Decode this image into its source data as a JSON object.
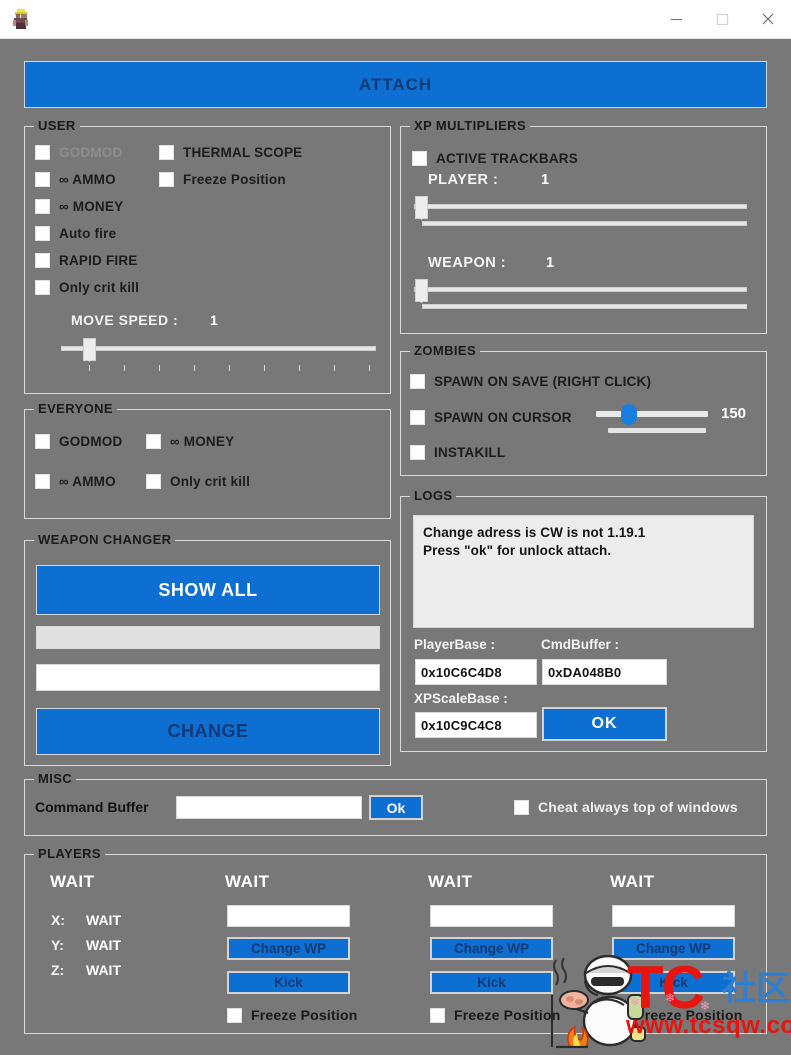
{
  "window": {
    "title": "",
    "icon": "app-character-icon",
    "minimize_label": "–",
    "maximize_label": "☐",
    "close_label": "✕"
  },
  "colors": {
    "accent_blue": "#0d6fd1",
    "window_bg": "#787878",
    "group_border": "#d9d9d9",
    "button_text": "#ffffff",
    "dark_button_text": "#113a78",
    "disabled_text": "#8e8e8e",
    "slider_thumb": "#1a7ee0",
    "watermark_red": "#e8140f",
    "watermark_blue": "#2f7fd0"
  },
  "attach": {
    "label": "ATTACH"
  },
  "user": {
    "legend": "USER",
    "checks_col1": [
      {
        "label": "GODMOD",
        "checked": false,
        "disabled": true
      },
      {
        "label": "∞ AMMO",
        "checked": false,
        "disabled": false
      },
      {
        "label": "∞ MONEY",
        "checked": false,
        "disabled": false
      },
      {
        "label": "Auto fire",
        "checked": false,
        "disabled": false
      },
      {
        "label": "RAPID FIRE",
        "checked": false,
        "disabled": false
      },
      {
        "label": "Only crit kill",
        "checked": false,
        "disabled": false
      }
    ],
    "checks_col2": [
      {
        "label": "THERMAL SCOPE",
        "checked": false,
        "disabled": false
      },
      {
        "label": "Freeze Position",
        "checked": false,
        "disabled": false
      }
    ],
    "move_speed": {
      "label": "MOVE SPEED :",
      "value": "1",
      "min": 1,
      "max": 10,
      "ticks": 10
    }
  },
  "everyone": {
    "legend": "EVERYONE",
    "checks": [
      {
        "label": "GODMOD",
        "checked": false
      },
      {
        "label": "∞ MONEY",
        "checked": false
      },
      {
        "label": "∞ AMMO",
        "checked": false
      },
      {
        "label": "Only crit kill",
        "checked": false
      }
    ]
  },
  "weapon_changer": {
    "legend": "WEAPON CHANGER",
    "show_all_label": "SHOW ALL",
    "list_value": "",
    "input_value": "",
    "change_label": "CHANGE"
  },
  "xp_multipliers": {
    "legend": "XP MULTIPLIERS",
    "active_trackbars": {
      "label": "ACTIVE TRACKBARS",
      "checked": false
    },
    "player": {
      "label": "PLAYER :",
      "value": "1",
      "min": 1,
      "max": 100
    },
    "weapon": {
      "label": "WEAPON :",
      "value": "1",
      "min": 1,
      "max": 100
    }
  },
  "zombies": {
    "legend": "ZOMBIES",
    "checks": [
      {
        "label": "SPAWN ON SAVE (RIGHT CLICK)",
        "checked": false
      },
      {
        "label": "SPAWN ON CURSOR",
        "checked": false
      },
      {
        "label": "INSTAKILL",
        "checked": false
      }
    ],
    "count_slider": {
      "value": "150",
      "min": 0,
      "max": 500,
      "percent": 27
    }
  },
  "logs": {
    "legend": "LOGS",
    "text_lines": [
      "Change adress is CW is not 1.19.1",
      "Press \"ok\" for unlock attach."
    ],
    "player_base": {
      "label": "PlayerBase :",
      "value": "0x10C6C4D8"
    },
    "cmd_buffer": {
      "label": "CmdBuffer :",
      "value": "0xDA048B0"
    },
    "xp_scale_base": {
      "label": "XPScaleBase :",
      "value": "0x10C9C4C8"
    },
    "ok_label": "OK"
  },
  "misc": {
    "legend": "MISC",
    "command_buffer_label": "Command Buffer",
    "command_buffer_value": "",
    "ok_label": "Ok",
    "always_on_top": {
      "label": "Cheat always top of windows",
      "checked": false
    }
  },
  "players": {
    "legend": "PLAYERS",
    "columns": [
      {
        "name": "WAIT",
        "coords": [
          {
            "axis": "X:",
            "value": "WAIT"
          },
          {
            "axis": "Y:",
            "value": "WAIT"
          },
          {
            "axis": "Z:",
            "value": "WAIT"
          }
        ]
      },
      {
        "name": "WAIT",
        "input_value": "",
        "change_wp_label": "Change WP",
        "kick_label": "Kick",
        "freeze_label": "Freeze Position",
        "freeze_checked": false
      },
      {
        "name": "WAIT",
        "input_value": "",
        "change_wp_label": "Change WP",
        "kick_label": "Kick",
        "freeze_label": "Freeze Position",
        "freeze_checked": false
      },
      {
        "name": "WAIT",
        "input_value": "",
        "change_wp_label": "Change WP",
        "kick_label": "Kick",
        "freeze_label": "Freeze Position",
        "freeze_checked": false
      }
    ]
  },
  "watermark": {
    "tc": "TC",
    "cn": "社区",
    "url": "www.tcsqw.com"
  }
}
